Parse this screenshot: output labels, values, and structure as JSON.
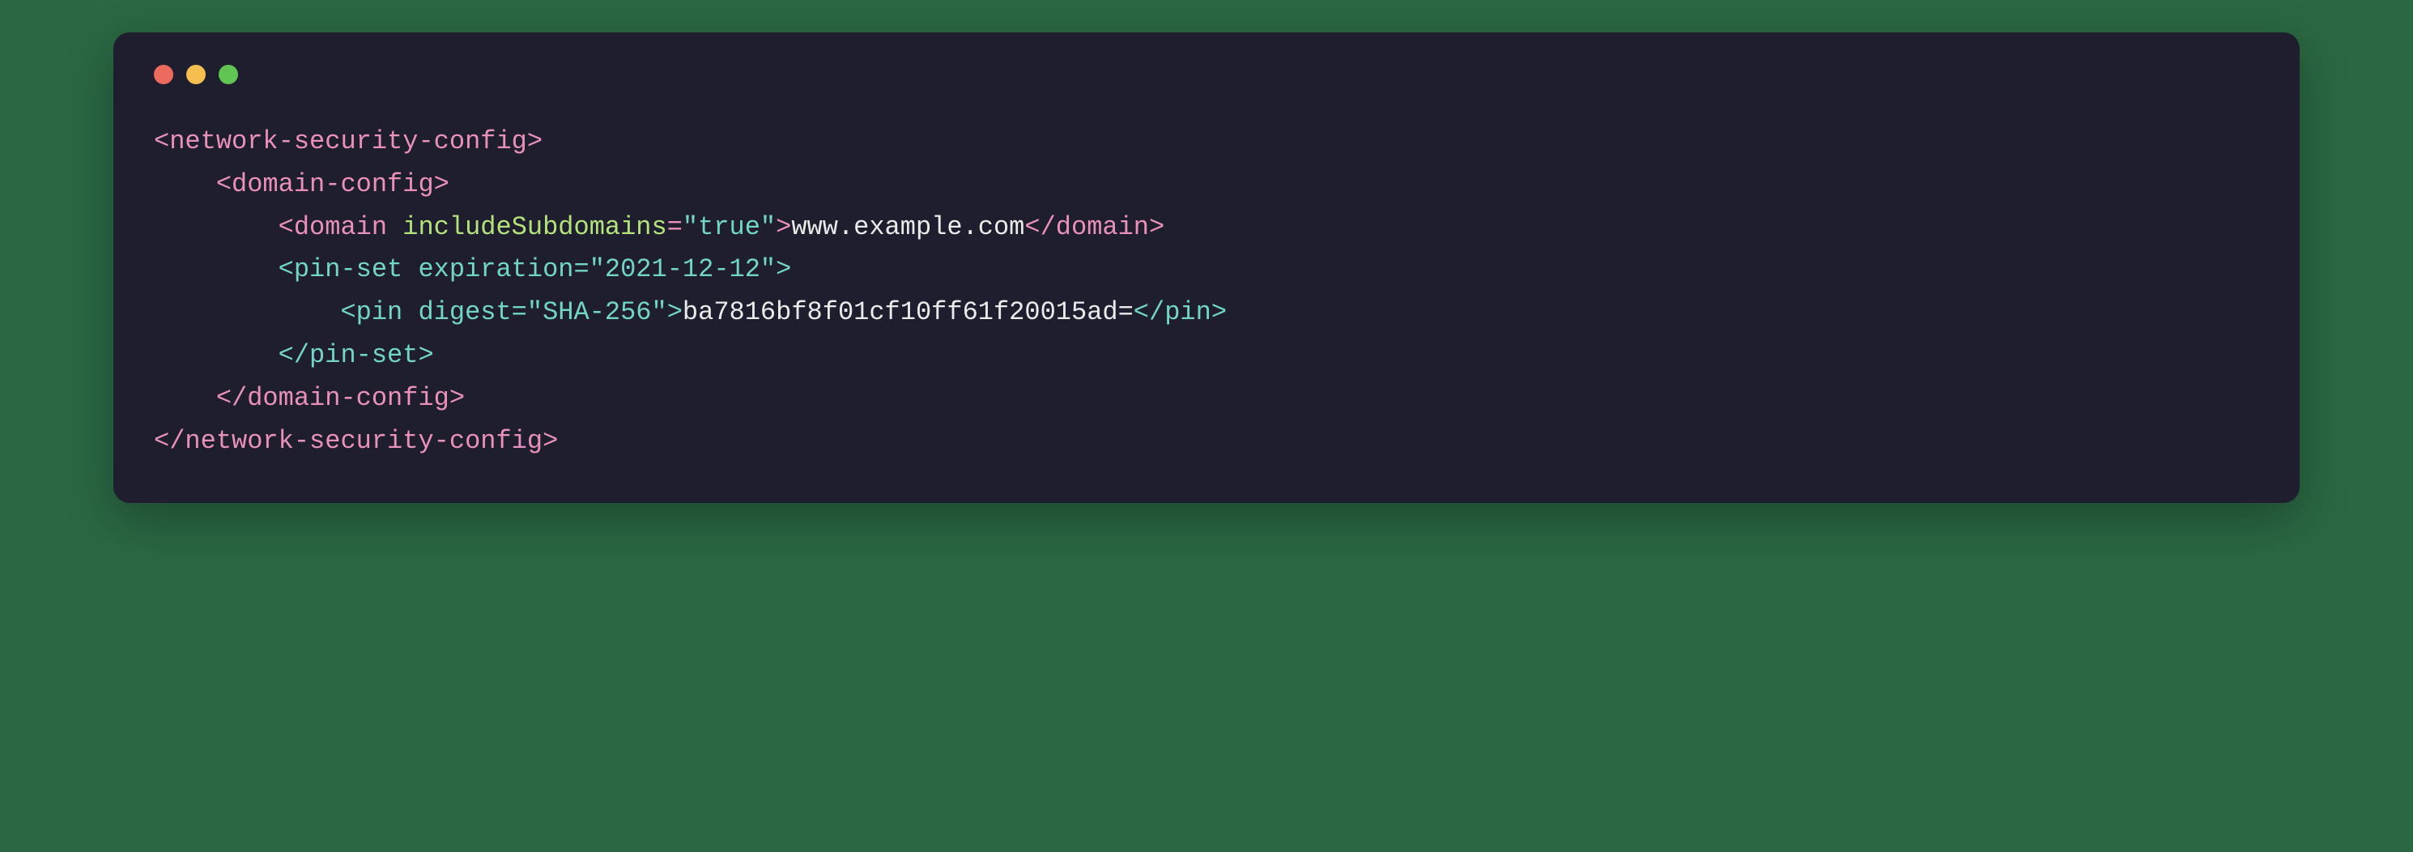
{
  "window": {
    "dot_colors": {
      "red": "#ed6a5e",
      "yellow": "#f4bf4f",
      "green": "#61c554"
    }
  },
  "code": {
    "root_open": "<network-security-config>",
    "domain_config_open": "<domain-config>",
    "domain_open_left": "<domain ",
    "domain_attr_name": "includeSubdomains",
    "domain_eq": "=",
    "domain_attr_value": "\"true\"",
    "domain_open_right": ">",
    "domain_text": "www.example.com",
    "domain_close": "</domain>",
    "pinset_open_left": "<pin-set ",
    "pinset_attr_name": "expiration",
    "pinset_attr_value": "=\"2021-12-12\">",
    "pin_open_left": "<pin ",
    "pin_attr_name": "digest",
    "pin_attr_value": "=\"SHA-256\">",
    "pin_text": "ba7816bf8f01cf10ff61f20015ad=",
    "pin_close": "</pin>",
    "pinset_close": "</pin-set>",
    "domain_config_close": "</domain-config>",
    "root_close": "</network-security-config>",
    "indent1": "    ",
    "indent2": "        ",
    "indent3": "            "
  }
}
